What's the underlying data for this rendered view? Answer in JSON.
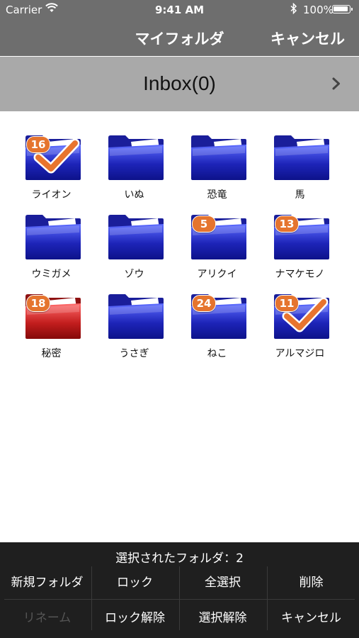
{
  "status_bar": {
    "carrier": "Carrier",
    "time": "9:41 AM",
    "battery": "100%"
  },
  "nav": {
    "title": "マイフォルダ",
    "cancel": "キャンセル"
  },
  "inbox": {
    "label": "Inbox(0)"
  },
  "folders": [
    {
      "name": "ライオン",
      "badge": "16",
      "checked": true,
      "color": "blue"
    },
    {
      "name": "いぬ",
      "badge": "",
      "checked": false,
      "color": "blue"
    },
    {
      "name": "恐竜",
      "badge": "",
      "checked": false,
      "color": "blue"
    },
    {
      "name": "馬",
      "badge": "",
      "checked": false,
      "color": "blue"
    },
    {
      "name": "ウミガメ",
      "badge": "",
      "checked": false,
      "color": "blue"
    },
    {
      "name": "ゾウ",
      "badge": "",
      "checked": false,
      "color": "blue"
    },
    {
      "name": "アリクイ",
      "badge": "5",
      "checked": false,
      "color": "blue"
    },
    {
      "name": "ナマケモノ",
      "badge": "13",
      "checked": false,
      "color": "blue"
    },
    {
      "name": "秘密",
      "badge": "18",
      "checked": false,
      "color": "red"
    },
    {
      "name": "うさぎ",
      "badge": "",
      "checked": false,
      "color": "blue"
    },
    {
      "name": "ねこ",
      "badge": "24",
      "checked": false,
      "color": "blue"
    },
    {
      "name": "アルマジロ",
      "badge": "11",
      "checked": true,
      "color": "blue"
    }
  ],
  "toolbar": {
    "selected_label": "選択されたフォルダ：2",
    "new_folder": "新規フォルダ",
    "lock": "ロック",
    "select_all": "全選択",
    "delete": "削除",
    "rename": "リネーム",
    "unlock": "ロック解除",
    "deselect": "選択解除",
    "cancel": "キャンセル"
  },
  "colors": {
    "nav_bg": "#6e6e6e",
    "inbox_bg": "#a9a9a9",
    "badge": "#e5742e",
    "checkmark": "#e8742e",
    "folder_blue": "#2a36c8",
    "folder_red": "#c72222",
    "toolbar_bg": "#1f1f1f"
  }
}
